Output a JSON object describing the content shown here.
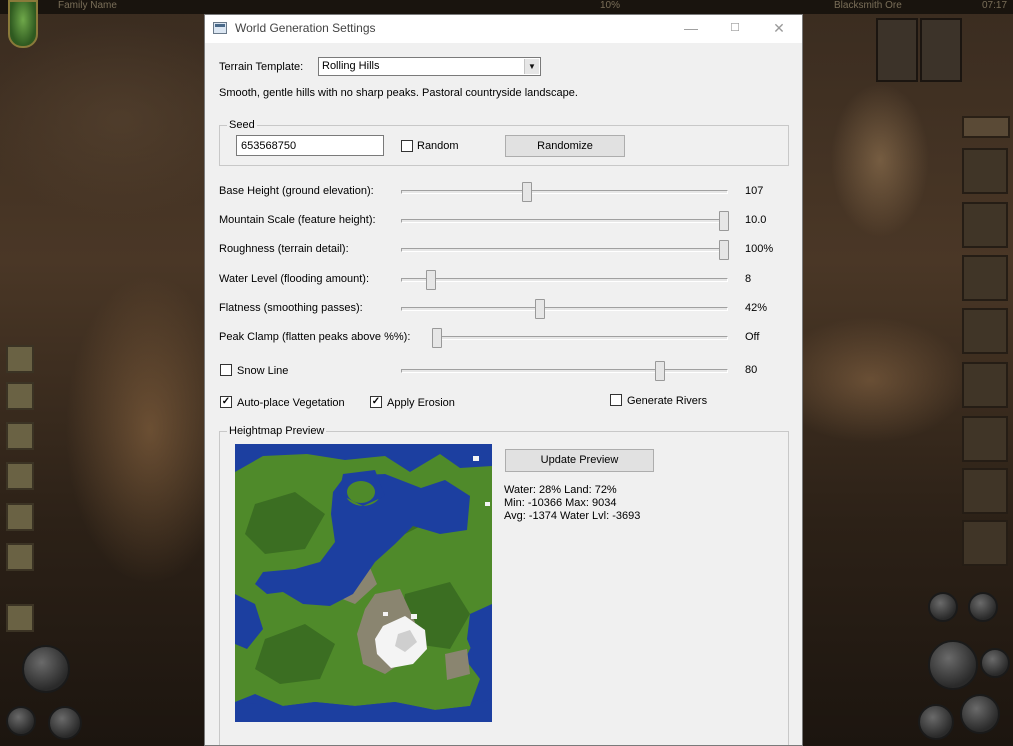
{
  "window": {
    "title": "World Generation Settings",
    "controls": {
      "minimize": "—",
      "maximize": "☐",
      "close": "✕"
    }
  },
  "terrain_template": {
    "label": "Terrain Template:",
    "selected": "Rolling Hills",
    "description": "Smooth, gentle hills with no sharp peaks. Pastoral countryside landscape."
  },
  "seed": {
    "group_label": "Seed",
    "value": "653568750",
    "random_label": "Random",
    "random_checked": false,
    "randomize_button": "Randomize"
  },
  "sliders": [
    {
      "id": "base-height",
      "label": "Base Height (ground elevation):",
      "value_text": "107",
      "position": 0.39
    },
    {
      "id": "mountain-scale",
      "label": "Mountain Scale (feature height):",
      "value_text": "10.0",
      "position": 1.0
    },
    {
      "id": "roughness",
      "label": "Roughness (terrain detail):",
      "value_text": "100%",
      "position": 1.0
    },
    {
      "id": "water-level",
      "label": "Water Level (flooding amount):",
      "value_text": "8",
      "position": 0.09
    },
    {
      "id": "flatness",
      "label": "Flatness (smoothing passes):",
      "value_text": "42%",
      "position": 0.42
    },
    {
      "id": "peak-clamp",
      "label": "Peak Clamp (flatten peaks above %%):",
      "value_text": "Off",
      "position": 0.0
    },
    {
      "id": "snow-line",
      "label": "Snow Line",
      "value_text": "80",
      "position": 0.8
    }
  ],
  "checkboxes": {
    "snow_line": {
      "label": "Snow Line",
      "checked": false
    },
    "vegetation": {
      "label": "Auto-place Vegetation",
      "checked": true
    },
    "erosion": {
      "label": "Apply Erosion",
      "checked": true
    },
    "rivers": {
      "label": "Generate Rivers",
      "checked": false
    }
  },
  "preview": {
    "group_label": "Heightmap Preview",
    "update_button": "Update Preview",
    "stats": [
      "Water: 28%  Land: 72%",
      "Min: -10366  Max: 9034",
      "Avg: -1374  Water Lvl: -3693"
    ]
  },
  "background": {
    "top_left_text": "Family Name",
    "top_center_text": "10%",
    "top_right_text": "Blacksmith Ore",
    "top_far_right_text": "07:17"
  },
  "colors": {
    "water": "#1c3fa0",
    "water_dark": "#0f2a80",
    "grass": "#4f8a2a",
    "grass_dark": "#2f5a1c",
    "dirt": "#8a8570",
    "snow": "#f4f4f4"
  }
}
